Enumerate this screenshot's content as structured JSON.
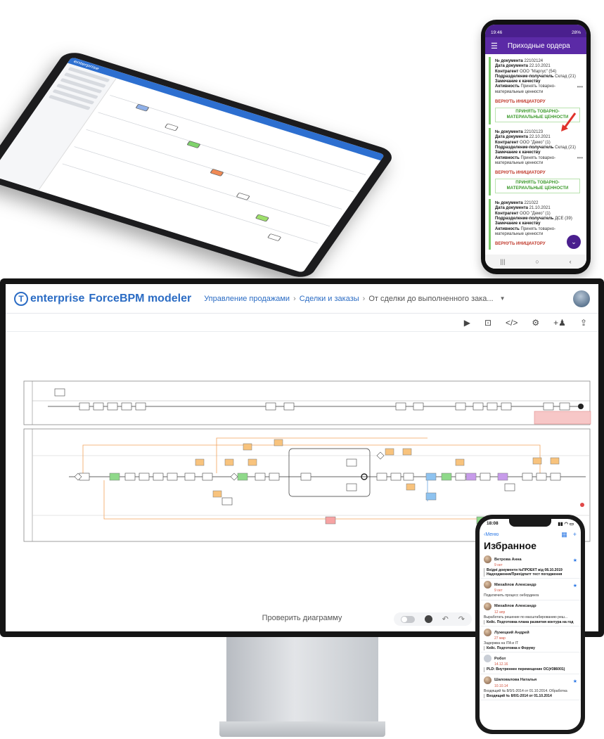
{
  "tablet": {
    "title": "enterprise"
  },
  "android": {
    "status_time": "19:46",
    "status_battery": "28%",
    "title": "Приходные ордера",
    "documents": [
      {
        "number_label": "№ документа",
        "number": "22102124",
        "date_label": "Дата документа",
        "date": "22.10.2021",
        "contractor_label": "Контрагент",
        "contractor": "ООО \"Маргус\" (54)",
        "unit_label": "Подразделение-получатель",
        "unit": "Склад (21)",
        "remark_label": "Замечание к качеству",
        "activity_label": "Активность",
        "activity": "Принять товарно-материальные ценности",
        "return_label": "ВЕРНУТЬ ИНИЦИАТОРУ",
        "accept_label": "ПРИНЯТЬ ТОВАРНО-МАТЕРИАЛЬНЫЕ ЦЕННОСТИ"
      },
      {
        "number_label": "№ документа",
        "number": "22102123",
        "date_label": "Дата документа",
        "date": "22.10.2021",
        "contractor_label": "Контрагент",
        "contractor": "ООО \"Демо\" (1)",
        "unit_label": "Подразделение-получатель",
        "unit": "Склад (21)",
        "remark_label": "Замечание к качеству",
        "activity_label": "Активность",
        "activity": "Принять товарно-материальные ценности",
        "return_label": "ВЕРНУТЬ ИНИЦИАТОРУ",
        "accept_label": "ПРИНЯТЬ ТОВАРНО-МАТЕРИАЛЬНЫЕ ЦЕННОСТИ"
      },
      {
        "number_label": "№ документа",
        "number": "221022",
        "date_label": "Дата документа",
        "date": "21.10.2021",
        "contractor_label": "Контрагент",
        "contractor": "ООО \"Демо\" (1)",
        "unit_label": "Подразделение-получатель",
        "unit": "ДСЕ (39)",
        "remark_label": "Замечание к качеству",
        "activity_label": "Активность",
        "activity": "Принять товарно-материальные ценности",
        "return_label": "ВЕРНУТЬ ИНИЦИАТОРУ"
      }
    ]
  },
  "modeler": {
    "brand": "enterprise",
    "product": "ForceBPM modeler",
    "breadcrumbs": [
      "Управление продажами",
      "Сделки и заказы",
      "От сделки до выполненного зака..."
    ],
    "footer_label": "Проверить диаграмму"
  },
  "iphone": {
    "status_time": "18:08",
    "back_label": "Меню",
    "title": "Избранное",
    "items": [
      {
        "name": "Ветрова Анна",
        "time": "9 окт",
        "text": "",
        "sub": "Вхідні документи №ПРОЕКТ від 08.10.2019 Надходження/Прихідпатт тест погодження"
      },
      {
        "name": "Михайлов Александр",
        "time": "9 окт",
        "text": "Подключить процесс онбординга",
        "sub": ""
      },
      {
        "name": "Михайлов Александр",
        "time": "12 апр",
        "text": "Выработать решение по масштабированию реш...",
        "sub": "Кейс. Подготовка плана развития контура на год"
      },
      {
        "name": "Лужецкий Андрей",
        "time": "27 мар",
        "text": "Задержка на ITA и IT",
        "sub": "Кейс. Подготовка к Форуму"
      },
      {
        "name": "Робот",
        "time": "14.12.16",
        "text": "",
        "sub": "PLD: Внутреннее перемещение ОС(#386001)"
      },
      {
        "name": "Шаповалова Наталья",
        "time": "10.10.14",
        "text": "Входящий № 8/0/1-2014 от 01.10.2014. Обработка",
        "sub": "Входящий № 8/0/1-2014 от 01.10.2014"
      }
    ]
  },
  "colors": {
    "brand_blue": "#2b6cc4",
    "android_purple": "#5b2aa6",
    "accept_green": "#3d9b2d",
    "return_red": "#c0392b"
  }
}
